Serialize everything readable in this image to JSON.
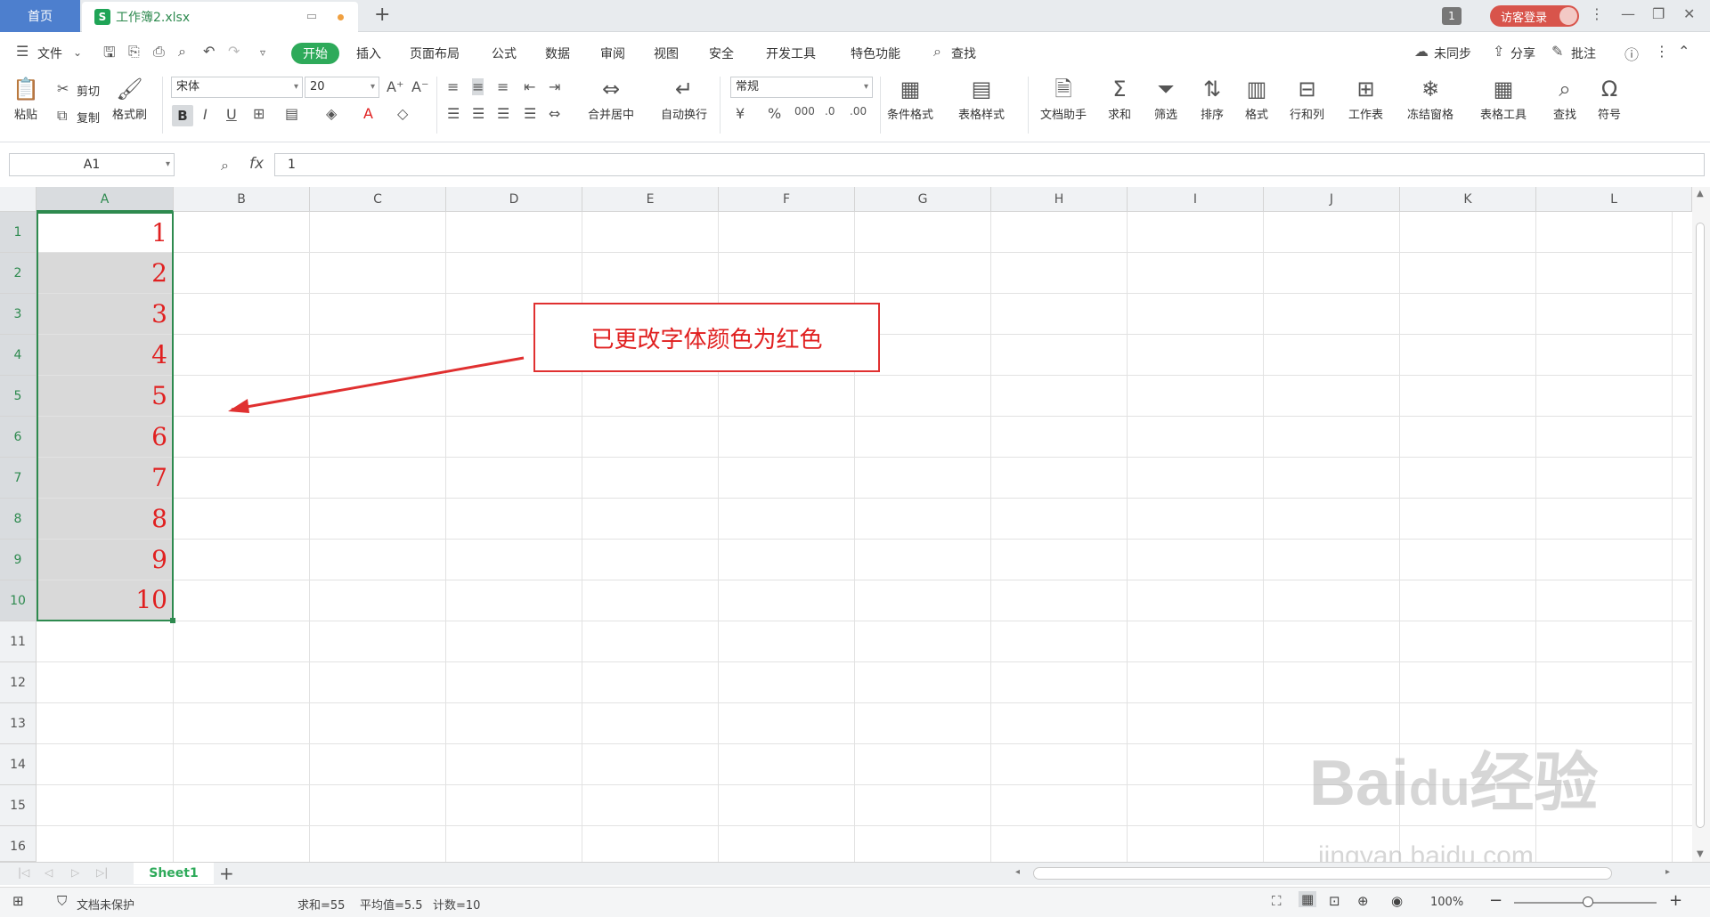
{
  "tabs": {
    "home": "首页",
    "file": "工作簿2.xlsx",
    "new": "+"
  },
  "titlebar": {
    "window_count": "1",
    "login": "访客登录"
  },
  "menu": {
    "file": "文件",
    "items": [
      "开始",
      "插入",
      "页面布局",
      "公式",
      "数据",
      "审阅",
      "视图",
      "安全",
      "开发工具",
      "特色功能"
    ],
    "active": "开始",
    "search": "查找",
    "sync": "未同步",
    "share": "分享",
    "comment": "批注"
  },
  "ribbon": {
    "paste": "粘贴",
    "cut": "剪切",
    "copy": "复制",
    "format_painter": "格式刷",
    "font_name": "宋体",
    "font_size": "20",
    "merge": "合并居中",
    "wrap": "自动换行",
    "number_format": "常规",
    "cond_format": "条件格式",
    "table_style": "表格样式",
    "doc_assist": "文档助手",
    "sum": "求和",
    "filter": "筛选",
    "sort": "排序",
    "format": "格式",
    "rowcol": "行和列",
    "worksheet": "工作表",
    "freeze": "冻结窗格",
    "table_tools": "表格工具",
    "find": "查找",
    "symbol": "符号"
  },
  "formula_bar": {
    "name_box": "A1",
    "fx": "fx",
    "value": "1"
  },
  "columns": [
    "A",
    "B",
    "C",
    "D",
    "E",
    "F",
    "G",
    "H",
    "I",
    "J",
    "K",
    "L"
  ],
  "rows": [
    "1",
    "2",
    "3",
    "4",
    "5",
    "6",
    "7",
    "8",
    "9",
    "10",
    "11",
    "12",
    "13",
    "14",
    "15",
    "16"
  ],
  "cells_A": [
    "1",
    "2",
    "3",
    "4",
    "5",
    "6",
    "7",
    "8",
    "9",
    "10"
  ],
  "annotation": "已更改字体颜色为红色",
  "sheet": {
    "name": "Sheet1"
  },
  "status": {
    "protect": "文档未保护",
    "sum": "求和=55",
    "avg": "平均值=5.5",
    "count": "计数=10",
    "zoom": "100%"
  },
  "watermark": {
    "logo": "Baidu经验",
    "url": "jingyan.baidu.com"
  },
  "colors": {
    "accent": "#2eaa5a",
    "font_red": "#e02020",
    "login_red": "#d8544b"
  }
}
